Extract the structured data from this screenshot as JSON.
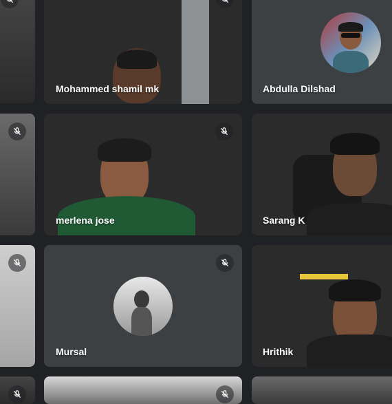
{
  "participants": [
    {
      "name": "Mohammed shamil mk",
      "muted": true
    },
    {
      "name": "Abdulla Dilshad",
      "muted": false
    },
    {
      "name": "merlena jose",
      "muted": true
    },
    {
      "name": "Sarang K",
      "muted": false
    },
    {
      "name": "Mursal",
      "muted": true
    },
    {
      "name": "Hrithik",
      "muted": false
    }
  ],
  "icons": {
    "mic_off": "mic-off-icon"
  },
  "colors": {
    "background": "#202124",
    "tile": "#3c4043"
  }
}
